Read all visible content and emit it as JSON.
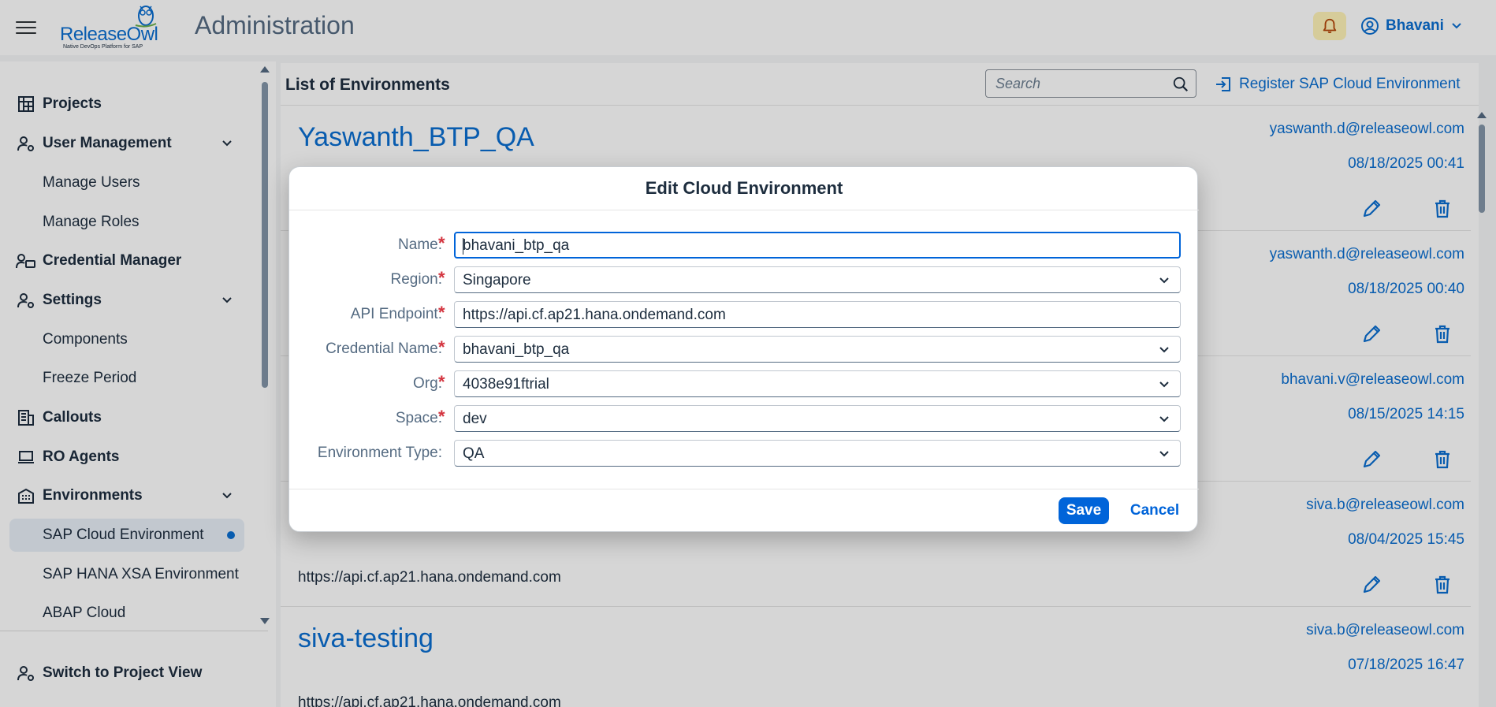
{
  "header": {
    "logo_text": "ReleaseOwl",
    "logo_tagline": "Native DevOps Platform for SAP",
    "title": "Administration",
    "user_name": "Bhavani",
    "icons": {
      "menu": "hamburger-icon",
      "bell": "bell-icon",
      "user": "user-circle-icon"
    },
    "bell_bg": "#fff3b8"
  },
  "sidebar": {
    "items": [
      {
        "label": "Projects",
        "icon": "projects-icon",
        "type": "group"
      },
      {
        "label": "User Management",
        "icon": "user-settings-icon",
        "type": "group",
        "expandable": true
      },
      {
        "label": "Manage Users",
        "type": "sub"
      },
      {
        "label": "Manage Roles",
        "type": "sub"
      },
      {
        "label": "Credential Manager",
        "icon": "credential-icon",
        "type": "group"
      },
      {
        "label": "Settings",
        "icon": "user-settings-icon",
        "type": "group",
        "expandable": true
      },
      {
        "label": "Components",
        "type": "sub"
      },
      {
        "label": "Freeze Period",
        "type": "sub"
      },
      {
        "label": "Callouts",
        "icon": "callouts-icon",
        "type": "group"
      },
      {
        "label": "RO Agents",
        "icon": "laptop-icon",
        "type": "group"
      },
      {
        "label": "Environments",
        "icon": "building-icon",
        "type": "group",
        "expandable": true
      },
      {
        "label": "SAP Cloud Environment",
        "type": "sub",
        "selected": true
      },
      {
        "label": "SAP HANA XSA Environment",
        "type": "sub"
      },
      {
        "label": "ABAP Cloud",
        "type": "sub"
      }
    ],
    "footer": {
      "label": "Switch to Project View",
      "icon": "user-settings-icon"
    }
  },
  "main": {
    "title": "List of Environments",
    "search_placeholder": "Search",
    "register_label": "Register SAP Cloud Environment",
    "environments": [
      {
        "name": "Yaswanth_BTP_QA",
        "url": "",
        "email": "yaswanth.d@releaseowl.com",
        "date": "08/18/2025 00:41"
      },
      {
        "name": "",
        "url": "",
        "email": "yaswanth.d@releaseowl.com",
        "date": "08/18/2025 00:40"
      },
      {
        "name": "",
        "url": "",
        "email": "bhavani.v@releaseowl.com",
        "date": "08/15/2025 14:15"
      },
      {
        "name": "",
        "url": "https://api.cf.ap21.hana.ondemand.com",
        "email": "siva.b@releaseowl.com",
        "date": "08/04/2025 15:45"
      },
      {
        "name": "siva-testing",
        "url": "https://api.cf.ap21.hana.ondemand.com",
        "email": "siva.b@releaseowl.com",
        "date": "07/18/2025 16:47"
      }
    ]
  },
  "dialog": {
    "title": "Edit Cloud Environment",
    "fields": [
      {
        "label": "Name:",
        "required": true,
        "value": "bhavani_btp_qa",
        "kind": "text"
      },
      {
        "label": "Region:",
        "required": true,
        "value": "Singapore",
        "kind": "select"
      },
      {
        "label": "API Endpoint:",
        "required": true,
        "value": "https://api.cf.ap21.hana.ondemand.com",
        "kind": "text"
      },
      {
        "label": "Credential Name:",
        "required": true,
        "value": "bhavani_btp_qa",
        "kind": "select"
      },
      {
        "label": "Org:",
        "required": true,
        "value": "4038e91ftrial",
        "kind": "select"
      },
      {
        "label": "Space:",
        "required": true,
        "value": "dev",
        "kind": "select"
      },
      {
        "label": "Environment Type:",
        "required": false,
        "value": "QA",
        "kind": "select"
      }
    ],
    "save_label": "Save",
    "cancel_label": "Cancel",
    "required_marker": "*"
  },
  "colors": {
    "accent": "#0a6ed1",
    "primary_button": "#0064d9",
    "required": "#d4343f",
    "selected_nav_bg": "#e8eff7"
  }
}
